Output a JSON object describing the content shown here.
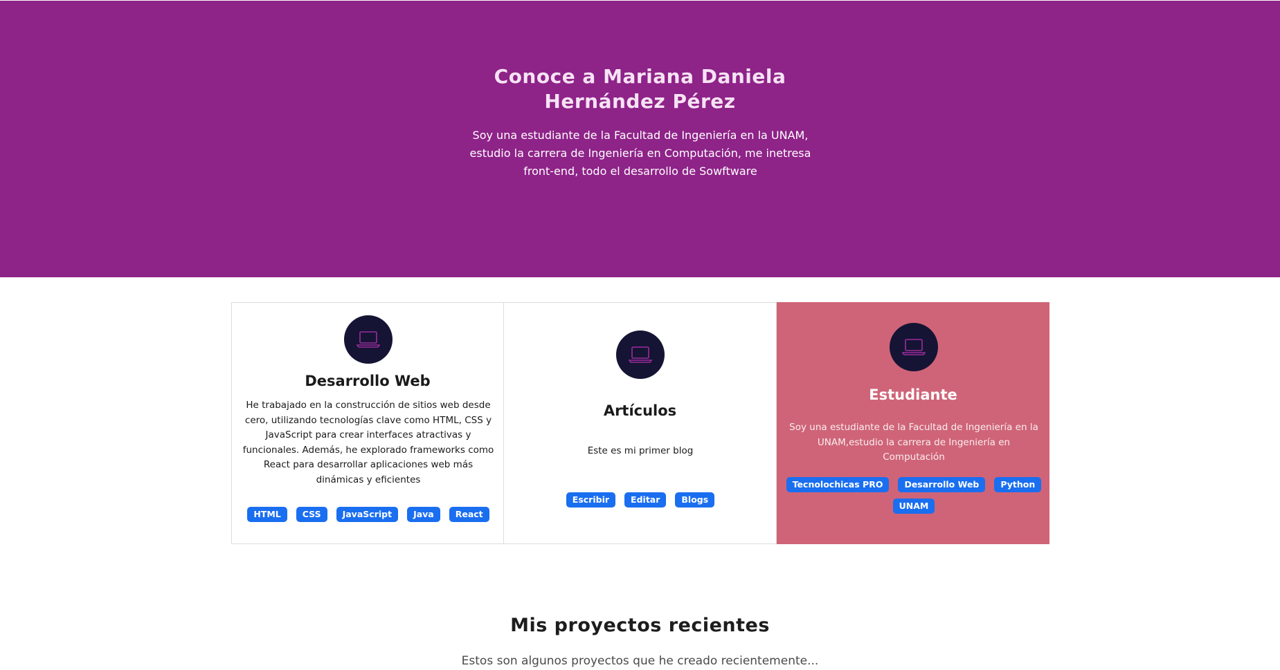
{
  "hero": {
    "title_line1": "Conoce a Mariana Daniela",
    "title_line2": "Hernández Pérez",
    "text": "Soy una estudiante de la Facultad de Ingeniería en la UNAM, estudio la carrera de Ingeniería en Computación, me inetresa front-end, todo el desarrollo de Sowftware"
  },
  "cards": [
    {
      "icon": "laptop-icon",
      "title": "Desarrollo Web",
      "text": "He trabajado en la construcción de sitios web desde cero, utilizando tecnologías clave como HTML, CSS y JavaScript para crear interfaces atractivas y funcionales. Además, he explorado frameworks como React para desarrollar aplicaciones web más dinámicas y eficientes",
      "tags": [
        "HTML",
        "CSS",
        "JavaScript",
        "Java",
        "React"
      ]
    },
    {
      "icon": "laptop-icon",
      "title": "Artículos",
      "text": "Este es mi primer blog",
      "tags": [
        "Escribir",
        "Editar",
        "Blogs"
      ]
    },
    {
      "icon": "laptop-icon",
      "title": "Estudiante",
      "text": "Soy una estudiante de la Facultad de Ingeniería en la UNAM,estudio la carrera de Ingeniería en Computación",
      "tags": [
        "Tecnolochicas PRO",
        "Desarrollo Web",
        "Python",
        "UNAM"
      ]
    }
  ],
  "projects": {
    "title": "Mis proyectos recientes",
    "subtitle": "Estos son algunos proyectos que he creado recientemente..."
  },
  "colors": {
    "hero_bg": "#8e2388",
    "highlight_card_bg": "#cf6478",
    "icon_circle_bg": "#151434",
    "icon_stroke": "#9b2d9b",
    "tag_bg": "#1a6ef0"
  }
}
